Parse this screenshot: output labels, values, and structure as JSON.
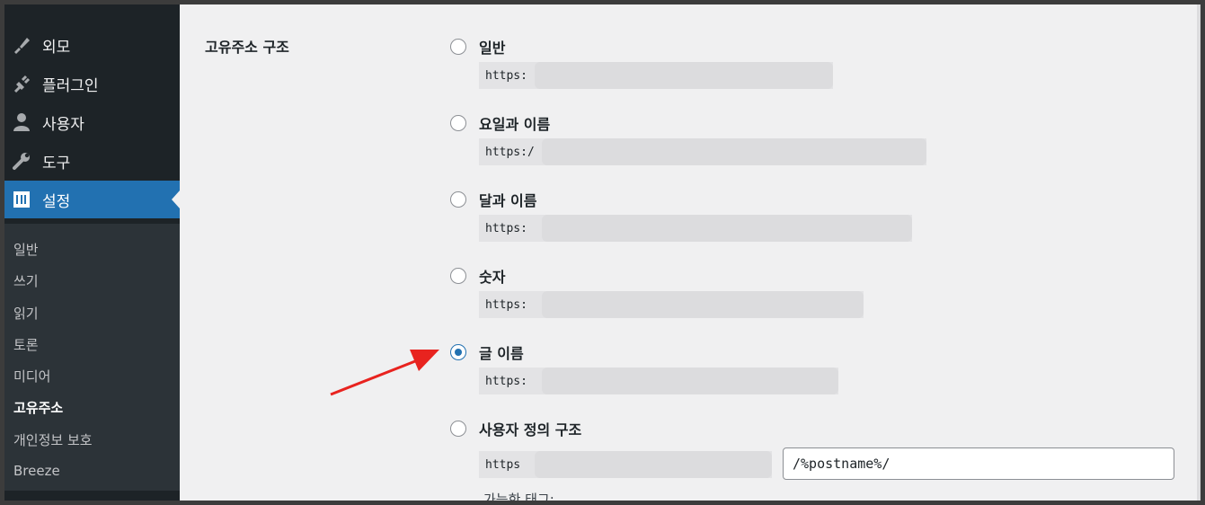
{
  "sidebar": {
    "menu": [
      {
        "label": "외모",
        "icon": "brush-icon"
      },
      {
        "label": "플러그인",
        "icon": "plugin-icon"
      },
      {
        "label": "사용자",
        "icon": "user-icon"
      },
      {
        "label": "도구",
        "icon": "wrench-icon"
      },
      {
        "label": "설정",
        "icon": "settings-icon",
        "active": true
      }
    ],
    "submenu": [
      {
        "label": "일반"
      },
      {
        "label": "쓰기"
      },
      {
        "label": "읽기"
      },
      {
        "label": "토론"
      },
      {
        "label": "미디어"
      },
      {
        "label": "고유주소",
        "current": true
      },
      {
        "label": "개인정보 보호"
      },
      {
        "label": "Breeze"
      }
    ]
  },
  "main": {
    "section_label": "고유주소 구조",
    "options": [
      {
        "label": "일반",
        "code": "https:",
        "checked": false
      },
      {
        "label": "요일과 이름",
        "code": "https:/",
        "checked": false
      },
      {
        "label": "달과 이름",
        "code": "https:",
        "checked": false
      },
      {
        "label": "숫자",
        "code": "https:",
        "checked": false
      },
      {
        "label": "글 이름",
        "code": "https:",
        "checked": true
      },
      {
        "label": "사용자 정의 구조",
        "code": "https",
        "checked": false
      }
    ],
    "custom_structure_value": "/%postname%/",
    "available_tags_label": "가능한 태그:"
  },
  "colors": {
    "accent": "#2271b1",
    "sidebar_bg": "#1d2327",
    "arrow": "#e8231f"
  }
}
